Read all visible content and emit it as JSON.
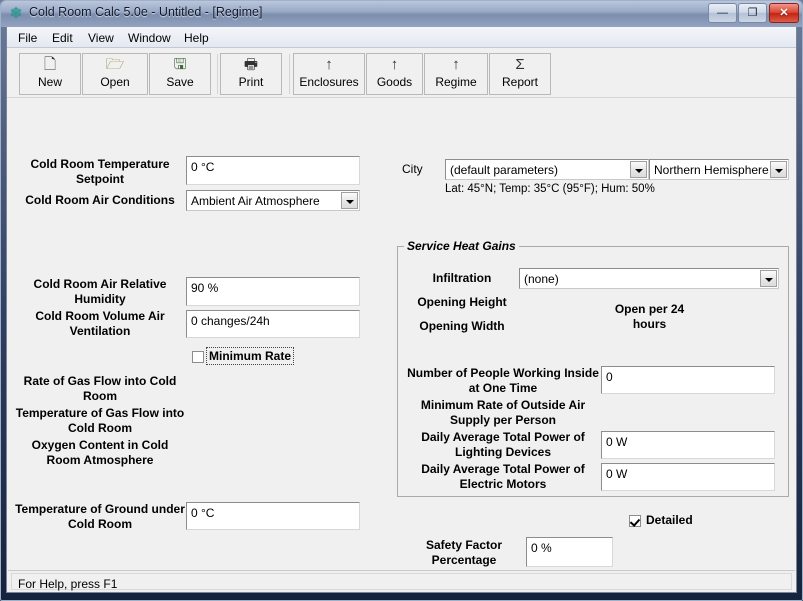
{
  "window": {
    "title": "Cold Room Calc 5.0e - Untitled - [Regime]",
    "icon": "snowflake-icon",
    "minimize_glyph": "—",
    "maximize_glyph": "❐",
    "close_glyph": "✕",
    "accent_close_color": "#c0392b",
    "title_bar_color": "#9aaac6"
  },
  "menu": {
    "items": [
      {
        "label": "File"
      },
      {
        "label": "Edit"
      },
      {
        "label": "View"
      },
      {
        "label": "Window"
      },
      {
        "label": "Help"
      }
    ]
  },
  "toolbar": {
    "buttons": [
      {
        "label": "New",
        "icon": "new-document-icon",
        "glyph": "🗋"
      },
      {
        "label": "Open",
        "icon": "open-folder-icon",
        "glyph": "🗁"
      },
      {
        "label": "Save",
        "icon": "floppy-disk-icon",
        "glyph": "🖫"
      },
      {
        "label": "Print",
        "icon": "printer-icon",
        "glyph": "🖶"
      },
      {
        "label": "Enclosures",
        "icon": "up-arrow-icon",
        "glyph": "↑"
      },
      {
        "label": "Goods",
        "icon": "up-arrow-icon",
        "glyph": "↑"
      },
      {
        "label": "Regime",
        "icon": "up-arrow-icon",
        "glyph": "↑"
      },
      {
        "label": "Report",
        "icon": "sigma-icon",
        "glyph": "Σ"
      }
    ]
  },
  "form": {
    "left": {
      "temperature_setpoint": {
        "label": "Cold Room Temperature Setpoint",
        "value": "0 °C"
      },
      "air_conditions": {
        "label": "Cold Room Air Conditions",
        "value": "Ambient Air Atmosphere"
      },
      "relative_humidity": {
        "label": "Cold Room Air Relative Humidity",
        "value": "90 %"
      },
      "volume_air_ventilation": {
        "label": "Cold Room Volume Air Ventilation",
        "value": "0 changes/24h"
      },
      "minimum_rate": {
        "label": "Minimum Rate",
        "checked": false
      },
      "gas_flow_rate": {
        "label": "Rate of Gas Flow into Cold Room",
        "value": ""
      },
      "gas_flow_temperature": {
        "label": "Temperature of Gas Flow into Cold Room",
        "value": ""
      },
      "oxygen_content": {
        "label": "Oxygen Content in Cold Room Atmosphere",
        "value": ""
      },
      "ground_temperature": {
        "label": "Temperature of Ground under Cold Room",
        "value": "0 °C"
      }
    },
    "right": {
      "city": {
        "label": "City",
        "value": "(default parameters)",
        "hemisphere": "Northern Hemisphere",
        "info": "Lat: 45°N; Temp: 35°C (95°F); Hum: 50%"
      },
      "service_heat_gains": {
        "title": "Service Heat Gains",
        "infiltration": {
          "label": "Infiltration",
          "value": "(none)"
        },
        "opening_height": {
          "label": "Opening Height",
          "value": ""
        },
        "opening_width": {
          "label": "Opening Width",
          "value": ""
        },
        "open_per_24_hours": {
          "label": "Open per 24 hours",
          "value": ""
        },
        "people_count": {
          "label": "Number of People Working Inside at One Time",
          "value": "0"
        },
        "outside_air_supply": {
          "label": "Minimum Rate of Outside Air Supply per Person",
          "value": ""
        },
        "lighting_power": {
          "label": "Daily Average Total Power of Lighting Devices",
          "value": "0 W"
        },
        "motor_power": {
          "label": "Daily Average Total Power of Electric Motors",
          "value": "0 W"
        }
      },
      "detailed": {
        "label": "Detailed",
        "checked": true
      },
      "safety_factor": {
        "label": "Safety Factor Percentage",
        "value": "0 %"
      }
    }
  },
  "status": {
    "text": "For Help, press F1"
  }
}
